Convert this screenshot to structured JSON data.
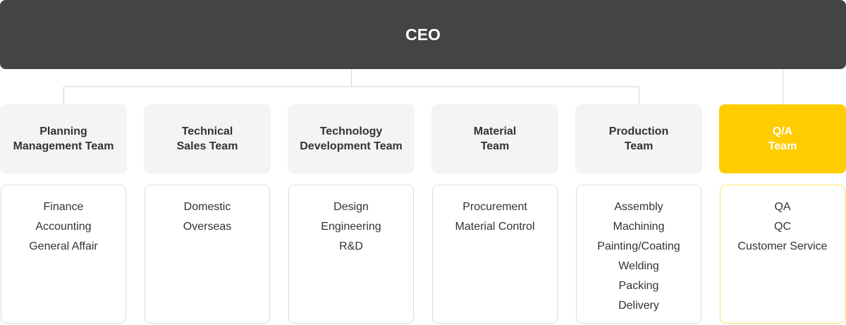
{
  "ceo": {
    "label": "CEO"
  },
  "colors": {
    "ceo_bg": "#444444",
    "accent": "#ffcc00",
    "team_bg": "#f4f4f4",
    "border": "#dddddd"
  },
  "teams": [
    {
      "line1": "Planning",
      "line2": "Management Team",
      "duties": [
        "Finance",
        "Accounting",
        "General Affair"
      ]
    },
    {
      "line1": "Technical",
      "line2": "Sales Team",
      "duties": [
        "Domestic",
        "Overseas"
      ]
    },
    {
      "line1": "Technology",
      "line2": "Development Team",
      "duties": [
        "Design",
        "Engineering",
        "R&D"
      ]
    },
    {
      "line1": "Material",
      "line2": "Team",
      "duties": [
        "Procurement",
        "Material Control"
      ]
    },
    {
      "line1": "Production",
      "line2": "Team",
      "duties": [
        "Assembly",
        "Machining",
        "Painting/Coating",
        "Welding",
        "Packing",
        "Delivery"
      ]
    },
    {
      "line1": "Q/A",
      "line2": "Team",
      "duties": [
        "QA",
        "QC",
        "Customer Service"
      ]
    }
  ]
}
